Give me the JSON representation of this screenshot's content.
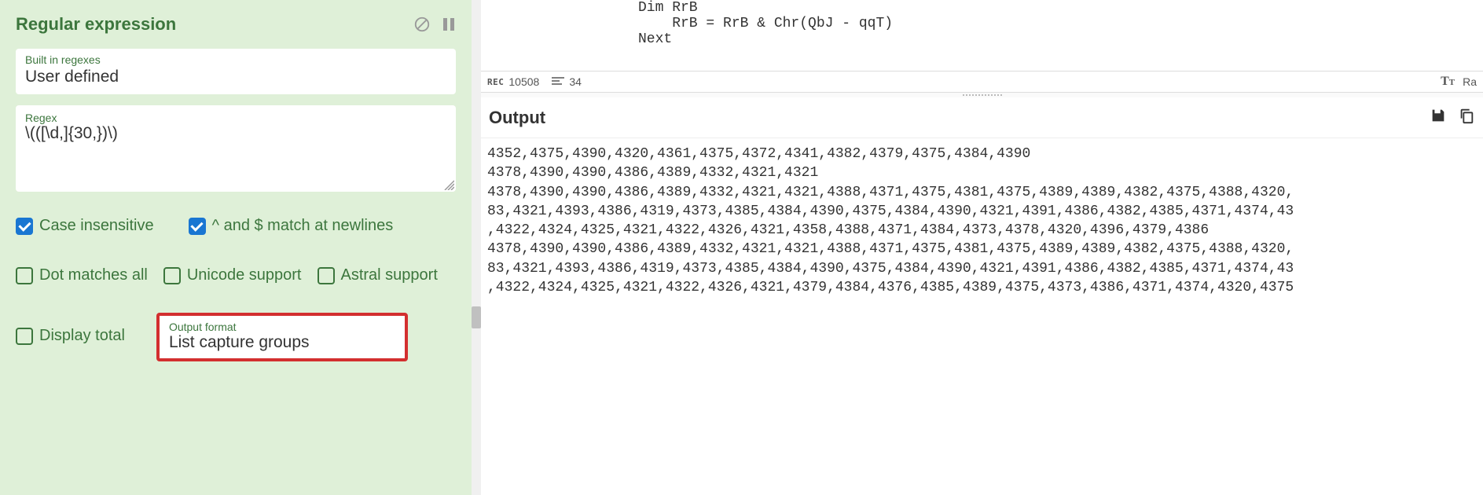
{
  "panel": {
    "title": "Regular expression",
    "builtin": {
      "label": "Built in regexes",
      "value": "User defined"
    },
    "regex": {
      "label": "Regex",
      "value": "\\(([\\d,]{30,})\\)"
    },
    "checks": {
      "case_insensitive": "Case insensitive",
      "match_newlines": "^ and $ match at newlines",
      "dot_all": "Dot matches all",
      "unicode": "Unicode support",
      "astral": "Astral support",
      "display_total": "Display total"
    },
    "output_format": {
      "label": "Output format",
      "value": "List capture groups"
    }
  },
  "code": {
    "line1": "Dim RrB",
    "line2": "    RrB = RrB & Chr(QbJ - qqT)",
    "line3": "Next"
  },
  "status": {
    "rec_label": "REC",
    "rec_count": "10508",
    "line_count": "34",
    "raw_label": "Ra"
  },
  "output": {
    "title": "Output",
    "lines": [
      "4352,4375,4390,4320,4361,4375,4372,4341,4382,4379,4375,4384,4390",
      "4378,4390,4390,4386,4389,4332,4321,4321",
      "4378,4390,4390,4386,4389,4332,4321,4321,4388,4371,4375,4381,4375,4389,4389,4382,4375,4388,4320,",
      "83,4321,4393,4386,4319,4373,4385,4384,4390,4375,4384,4390,4321,4391,4386,4382,4385,4371,4374,43",
      ",4322,4324,4325,4321,4322,4326,4321,4358,4388,4371,4384,4373,4378,4320,4396,4379,4386",
      "4378,4390,4390,4386,4389,4332,4321,4321,4388,4371,4375,4381,4375,4389,4389,4382,4375,4388,4320,",
      "83,4321,4393,4386,4319,4373,4385,4384,4390,4375,4384,4390,4321,4391,4386,4382,4385,4371,4374,43",
      ",4322,4324,4325,4321,4322,4326,4321,4379,4384,4376,4385,4389,4375,4373,4386,4371,4374,4320,4375"
    ]
  }
}
